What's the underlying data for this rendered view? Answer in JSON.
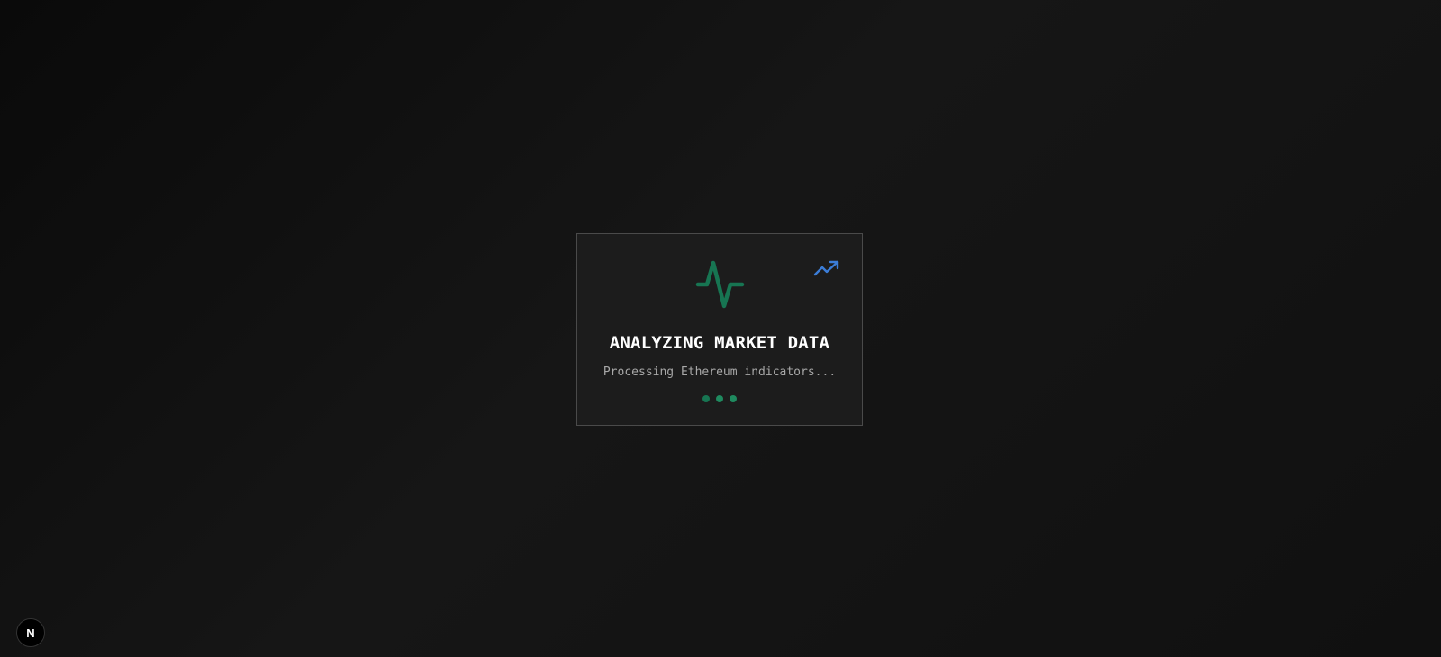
{
  "loading_card": {
    "title": "ANALYZING MARKET DATA",
    "subtitle": "Processing Ethereum indicators...",
    "main_icon": "activity-pulse-icon",
    "corner_icon": "trending-up-icon",
    "dot_count": 3
  },
  "dev_badge": {
    "label": "N",
    "icon": "nextjs-logo-icon"
  },
  "colors": {
    "background": "#111111",
    "card_background": "#1c1c1c",
    "card_border": "#4a4a4a",
    "pulse_green": "#177552",
    "dot_green": "#1f8a5f",
    "trend_blue": "#3b7dd8",
    "title_text": "#ffffff",
    "subtitle_text": "#a8a8a8"
  }
}
